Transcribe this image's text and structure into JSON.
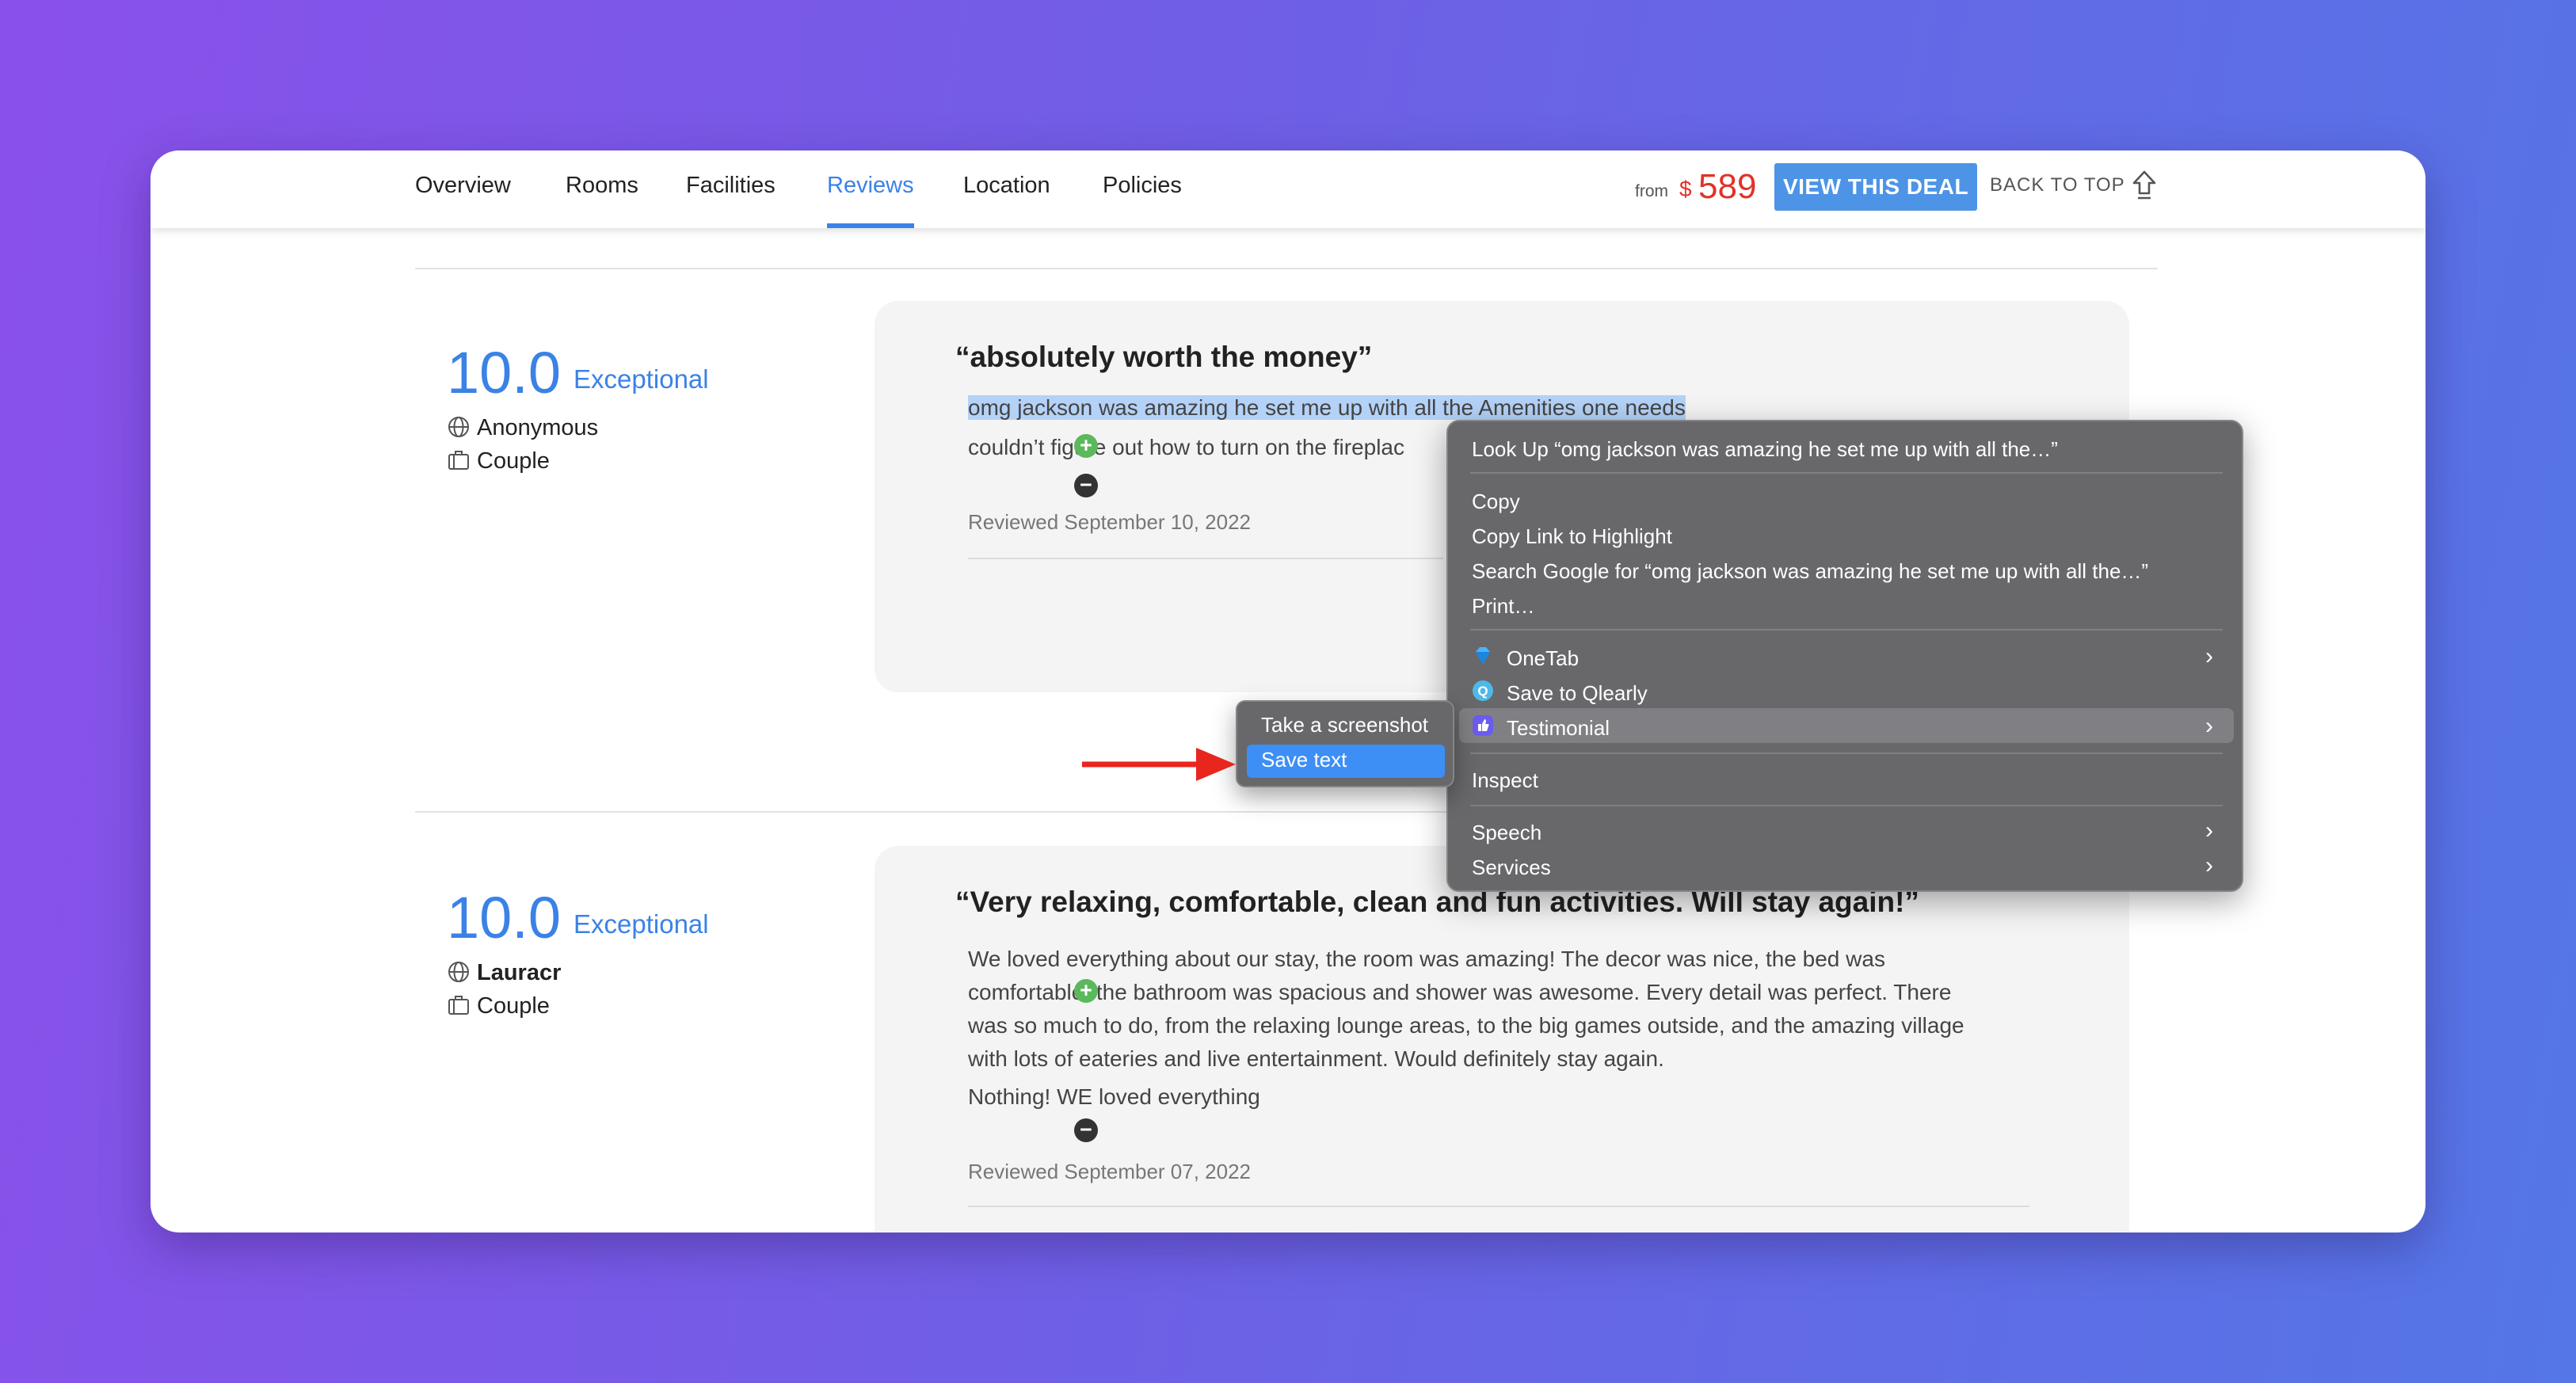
{
  "nav": {
    "tabs": [
      {
        "label": "Overview"
      },
      {
        "label": "Rooms"
      },
      {
        "label": "Facilities"
      },
      {
        "label": "Reviews",
        "active": true
      },
      {
        "label": "Location"
      },
      {
        "label": "Policies"
      }
    ],
    "from_label": "from",
    "currency": "$",
    "price": "589",
    "deal_button": "VIEW THIS DEAL",
    "back_to_top": "BACK TO TOP"
  },
  "reviews": [
    {
      "score": "10.0",
      "score_word": "Exceptional",
      "author": "Anonymous",
      "traveler_type": "Couple",
      "title": "“absolutely worth the money”",
      "positive_selected": "omg jackson was amazing he set me up with all the Amenities one needs",
      "negative": "couldn’t figure out how to turn on the fireplac",
      "reviewed": "Reviewed September 10, 2022"
    },
    {
      "score": "10.0",
      "score_word": "Exceptional",
      "author": "Lauracr",
      "traveler_type": "Couple",
      "title": "“Very relaxing, comfortable, clean and fun activities. Will stay again!”",
      "positive_lines": [
        "We loved everything about our stay, the room was amazing! The decor was nice, the bed was",
        "comfortable, the bathroom was spacious and shower was awesome. Every detail was perfect. There",
        "was so much to do, from the relaxing lounge areas, to the big games outside, and the amazing village",
        "with lots of eateries and live entertainment. Would definitely stay again."
      ],
      "negative": "Nothing! WE loved everything",
      "reviewed": "Reviewed September 07, 2022"
    }
  ],
  "context_menu": {
    "look_up": "Look Up “omg jackson was amazing he set me up with all the…”",
    "copy": "Copy",
    "copy_link": "Copy Link to Highlight",
    "search_google": "Search Google for “omg jackson was amazing he set me up with all the…”",
    "print": "Print…",
    "onetab": "OneTab",
    "save_qlearly": "Save to Qlearly",
    "testimonial": "Testimonial",
    "inspect": "Inspect",
    "speech": "Speech",
    "services": "Services"
  },
  "submenu": {
    "take_screenshot": "Take a screenshot",
    "save_text": "Save text"
  },
  "colors": {
    "accent": "#3b82e6",
    "price": "#e0332a",
    "menu_bg": "#68676a",
    "submenu_highlight": "#3d8ff5",
    "arrow": "#e8261e"
  }
}
